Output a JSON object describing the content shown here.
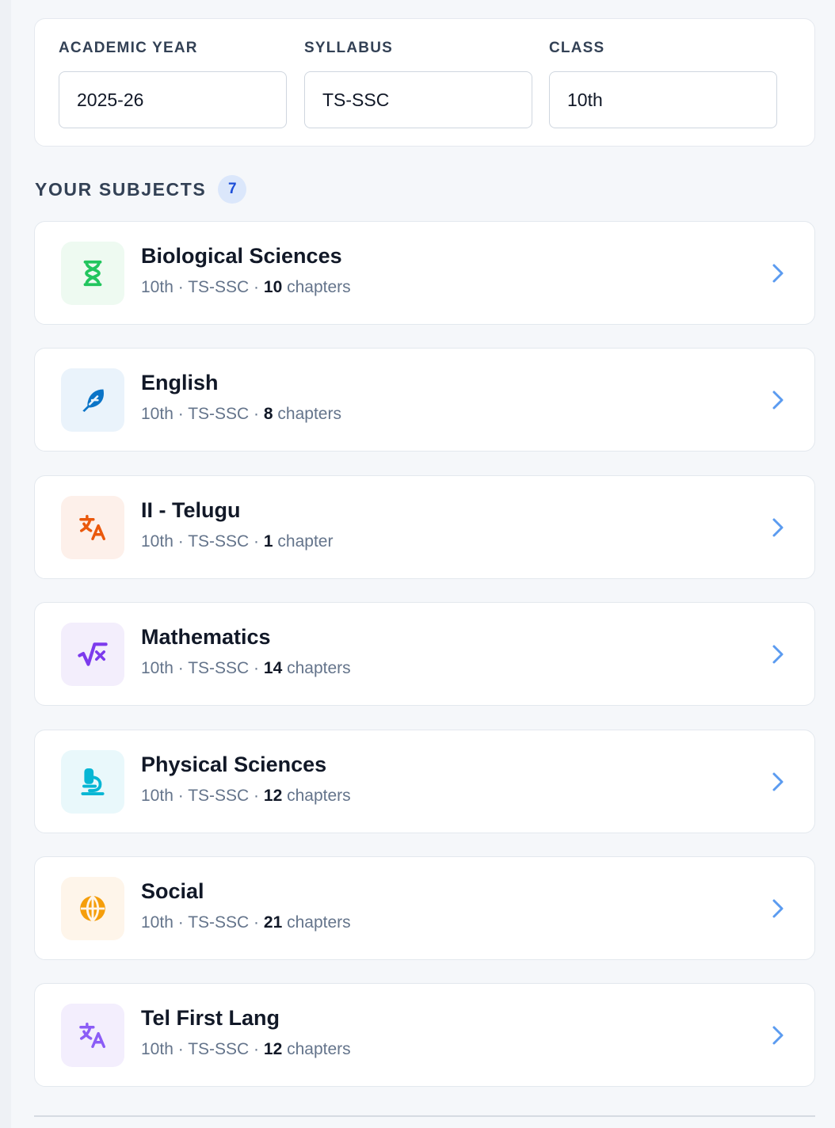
{
  "filters": {
    "academic_year": {
      "label": "ACADEMIC YEAR",
      "value": "2025-26"
    },
    "syllabus": {
      "label": "SYLLABUS",
      "value": "TS-SSC"
    },
    "class": {
      "label": "CLASS",
      "value": "10th"
    }
  },
  "subjects_section": {
    "title": "YOUR SUBJECTS",
    "count": "7"
  },
  "subjects": [
    {
      "name": "Biological Sciences",
      "class": "10th",
      "syllabus": "TS-SSC",
      "sep": "·",
      "chapters": "10",
      "unit": "chapters",
      "icon": "dna-icon",
      "icon_color": "#22c55e",
      "tile_color": "#eefaf1"
    },
    {
      "name": "English",
      "class": "10th",
      "syllabus": "TS-SSC",
      "sep": "·",
      "chapters": "8",
      "unit": "chapters",
      "icon": "feather-icon",
      "icon_color": "#0b74c7",
      "tile_color": "#eaf3fb"
    },
    {
      "name": "II - Telugu",
      "class": "10th",
      "syllabus": "TS-SSC",
      "sep": "·",
      "chapters": "1",
      "unit": "chapter",
      "icon": "translate-icon",
      "icon_color": "#ea580c",
      "tile_color": "#fdf0ea"
    },
    {
      "name": "Mathematics",
      "class": "10th",
      "syllabus": "TS-SSC",
      "sep": "·",
      "chapters": "14",
      "unit": "chapters",
      "icon": "square-root-icon",
      "icon_color": "#7c3aed",
      "tile_color": "#f3eefc"
    },
    {
      "name": "Physical Sciences",
      "class": "10th",
      "syllabus": "TS-SSC",
      "sep": "·",
      "chapters": "12",
      "unit": "chapters",
      "icon": "microscope-icon",
      "icon_color": "#06b6d4",
      "tile_color": "#e9f8fb"
    },
    {
      "name": "Social",
      "class": "10th",
      "syllabus": "TS-SSC",
      "sep": "·",
      "chapters": "21",
      "unit": "chapters",
      "icon": "globe-icon",
      "icon_color": "#f59e0b",
      "tile_color": "#fef5ea"
    },
    {
      "name": "Tel First Lang",
      "class": "10th",
      "syllabus": "TS-SSC",
      "sep": "·",
      "chapters": "12",
      "unit": "chapters",
      "icon": "translate-icon",
      "icon_color": "#8b5cf6",
      "tile_color": "#f3eefd"
    }
  ],
  "colors": {
    "accent": "#3b82f6",
    "chevron": "#5b9bf0"
  }
}
